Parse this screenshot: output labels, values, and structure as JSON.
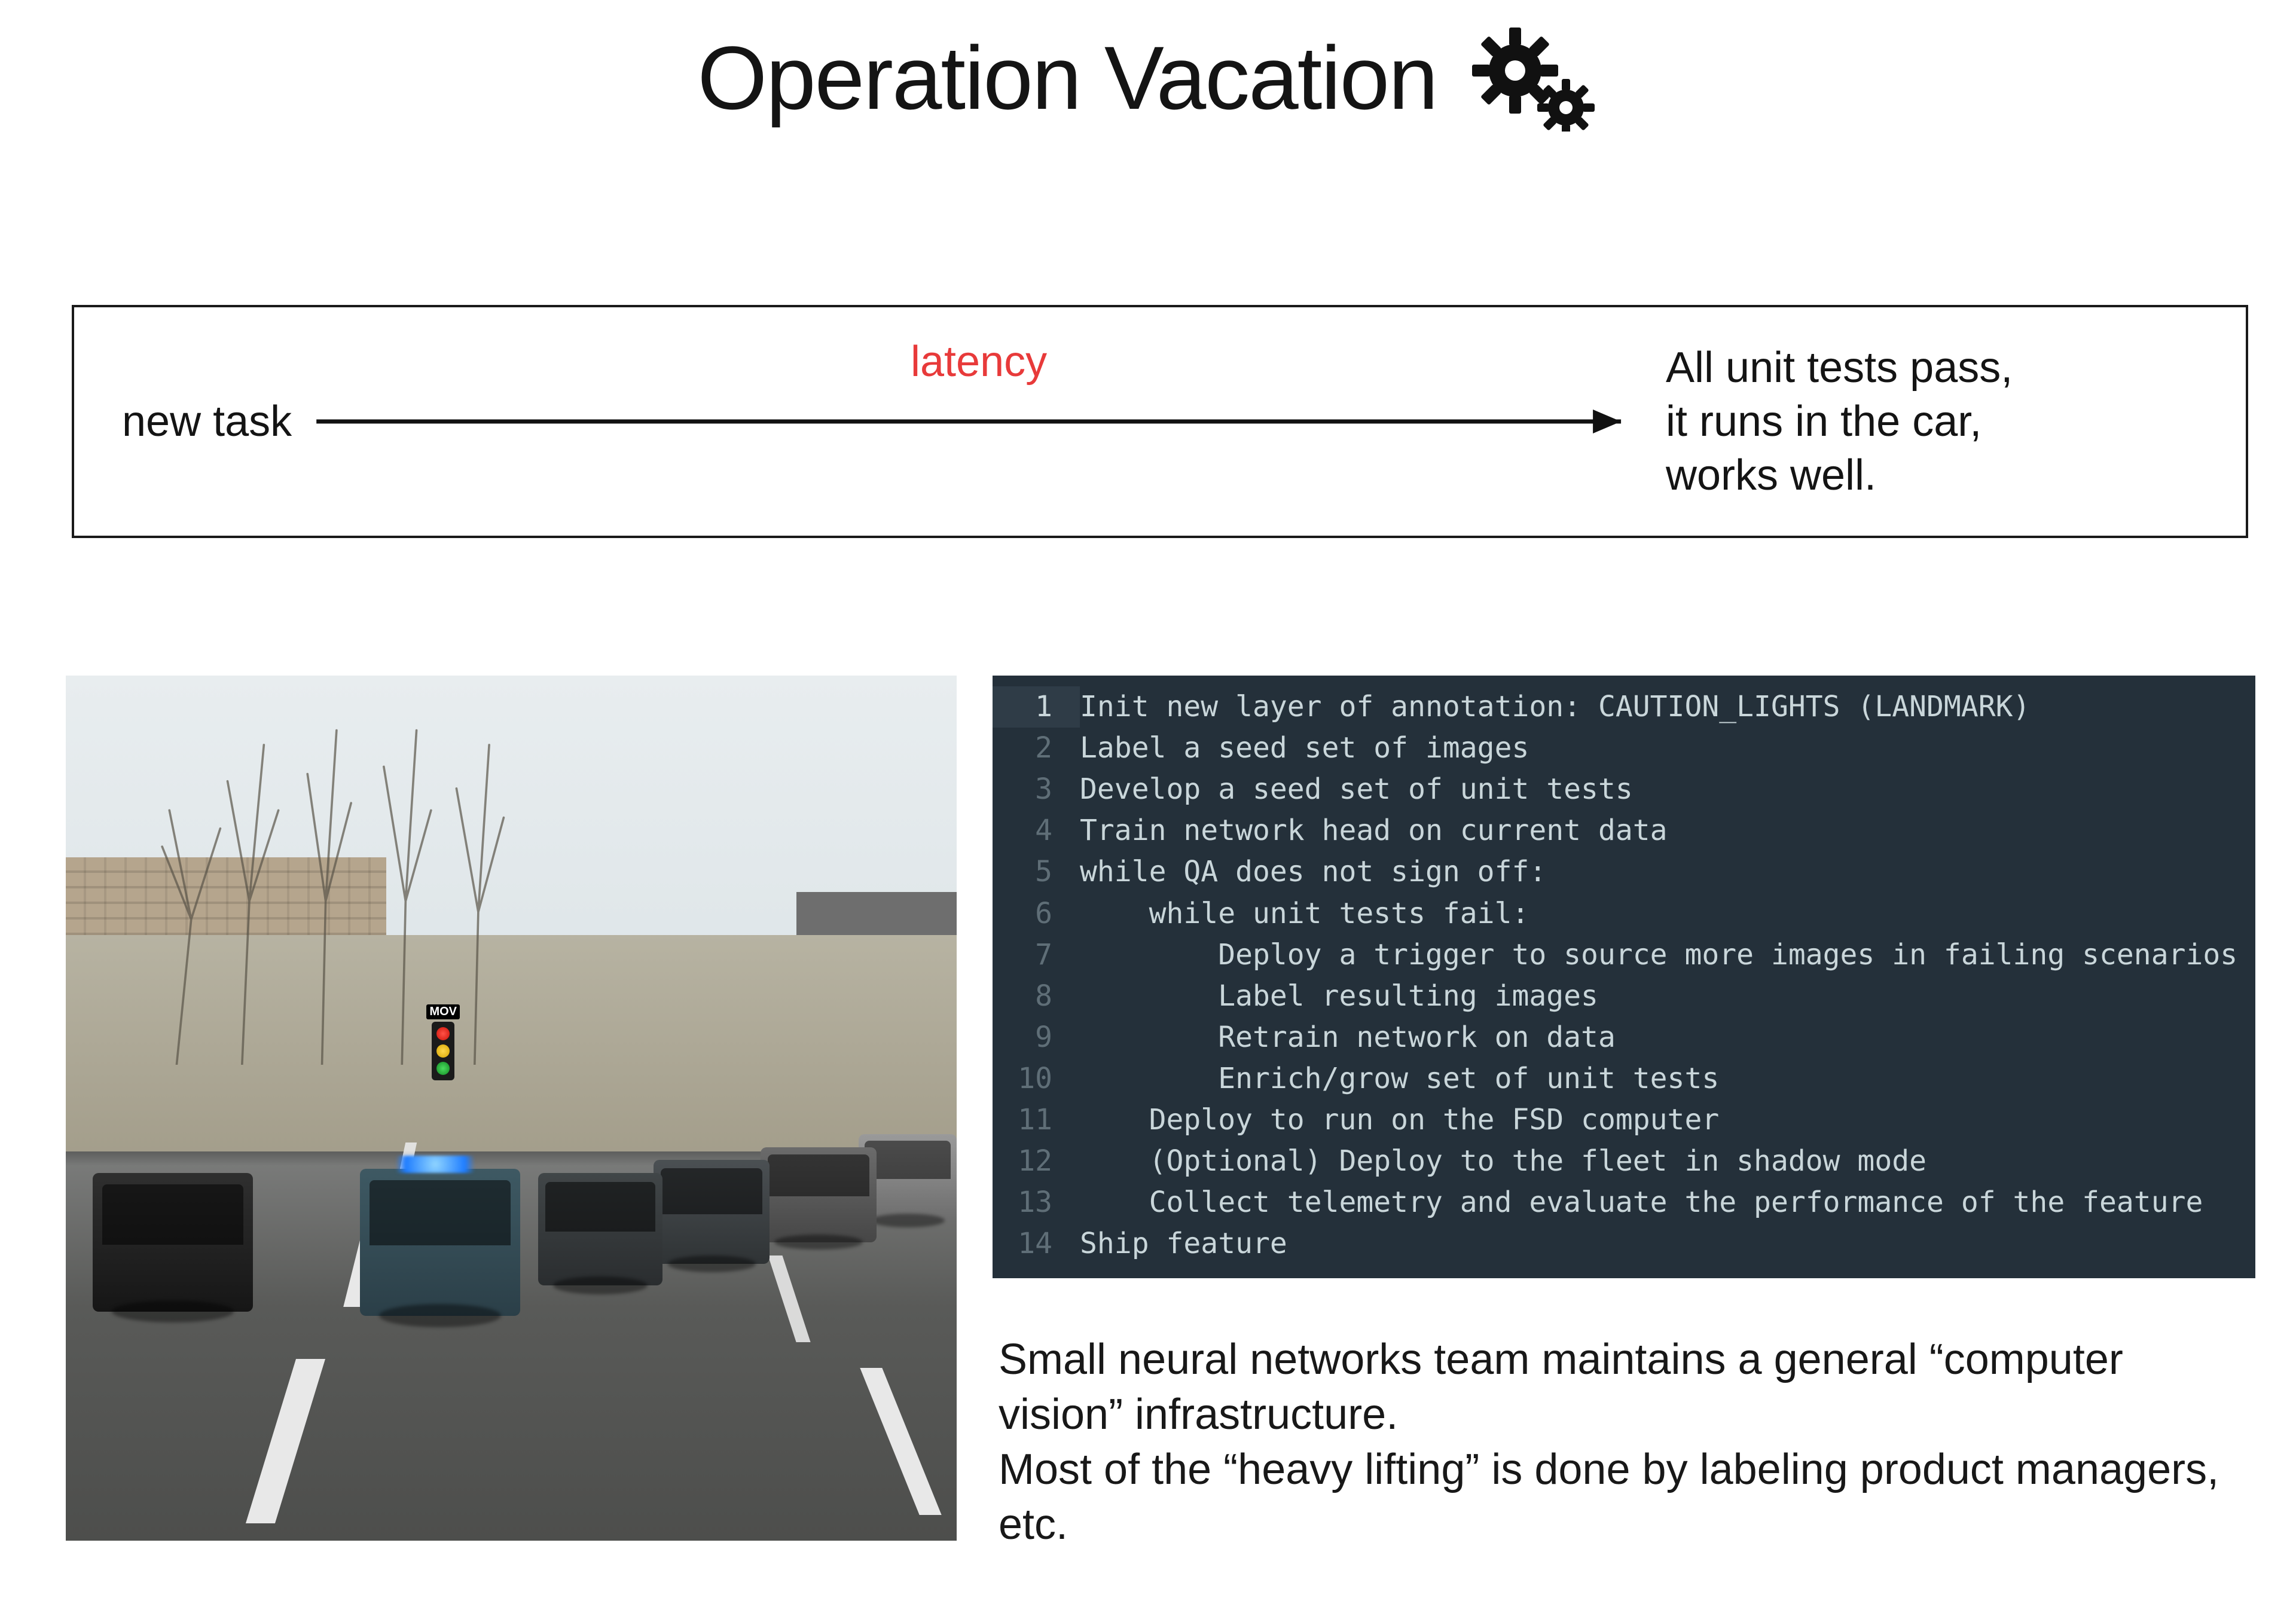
{
  "title": "Operation Vacation",
  "icon_name": "gears-icon",
  "latency": {
    "left": "new task",
    "arrow_label": "latency",
    "right": "All unit tests pass,\nit runs in the car,\nworks well."
  },
  "photo": {
    "alt": "Street scene with vehicles and traffic light detection overlay",
    "overlay_label": "MOV"
  },
  "code_lines": [
    {
      "n": 1,
      "indent": 0,
      "text": "Init new layer of annotation: CAUTION_LIGHTS (LANDMARK)"
    },
    {
      "n": 2,
      "indent": 0,
      "text": "Label a seed set of images"
    },
    {
      "n": 3,
      "indent": 0,
      "text": "Develop a seed set of unit tests"
    },
    {
      "n": 4,
      "indent": 0,
      "text": "Train network head on current data"
    },
    {
      "n": 5,
      "indent": 0,
      "text": "while QA does not sign off:"
    },
    {
      "n": 6,
      "indent": 1,
      "text": "while unit tests fail:"
    },
    {
      "n": 7,
      "indent": 2,
      "text": "Deploy a trigger to source more images in failing scenarios"
    },
    {
      "n": 8,
      "indent": 2,
      "text": "Label resulting images"
    },
    {
      "n": 9,
      "indent": 2,
      "text": "Retrain network on data"
    },
    {
      "n": 10,
      "indent": 2,
      "text": "Enrich/grow set of unit tests"
    },
    {
      "n": 11,
      "indent": 1,
      "text": "Deploy to run on the FSD computer"
    },
    {
      "n": 12,
      "indent": 1,
      "text": "(Optional) Deploy to the fleet in shadow mode"
    },
    {
      "n": 13,
      "indent": 1,
      "text": "Collect telemetry and evaluate the performance of the feature"
    },
    {
      "n": 14,
      "indent": 0,
      "text": "Ship feature"
    }
  ],
  "code_indent_unit": "    ",
  "code_highlight_line": 1,
  "paragraph": "Small neural networks team maintains a general “computer vision” infrastructure.\nMost of the “heavy lifting” is done by labeling product managers, etc."
}
